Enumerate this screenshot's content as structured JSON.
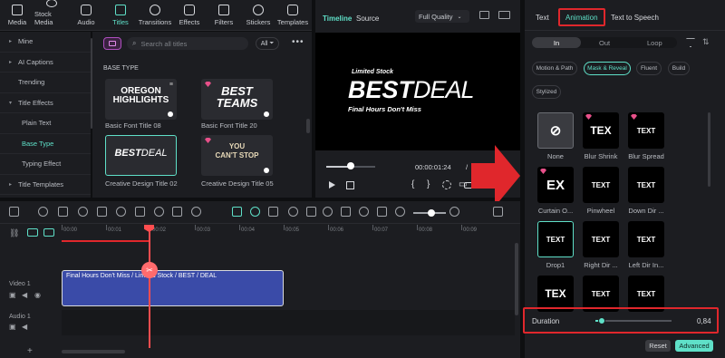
{
  "toolbar": {
    "tools": [
      {
        "label": "Media",
        "icon": "media-icon"
      },
      {
        "label": "Stock Media",
        "icon": "stock-media-icon"
      },
      {
        "label": "Audio",
        "icon": "audio-icon"
      },
      {
        "label": "Titles",
        "icon": "titles-icon"
      },
      {
        "label": "Transitions",
        "icon": "transitions-icon"
      },
      {
        "label": "Effects",
        "icon": "effects-icon"
      },
      {
        "label": "Filters",
        "icon": "filters-icon"
      },
      {
        "label": "Stickers",
        "icon": "stickers-icon"
      },
      {
        "label": "Templates",
        "icon": "templates-icon"
      }
    ],
    "active": "Titles"
  },
  "leftnav": {
    "items": [
      {
        "label": "Mine",
        "caret": "▸",
        "sub": false
      },
      {
        "label": "AI Captions",
        "caret": "▸",
        "sub": false
      },
      {
        "label": "Trending",
        "caret": "",
        "sub": false
      },
      {
        "label": "Title Effects",
        "caret": "▾",
        "sub": false
      },
      {
        "label": "Plain Text",
        "caret": "",
        "sub": true
      },
      {
        "label": "Base Type",
        "caret": "",
        "sub": true,
        "selected": true
      },
      {
        "label": "Typing Effect",
        "caret": "",
        "sub": true
      },
      {
        "label": "Title Templates",
        "caret": "▸",
        "sub": false
      }
    ]
  },
  "assets": {
    "search_placeholder": "Search all titles",
    "filter_label": "All",
    "section": "BASE TYPE",
    "items": [
      {
        "label": "Basic Font Title 08",
        "line1": "OREGON",
        "line2": "HIGHLIGHTS"
      },
      {
        "label": "Basic Font Title 20",
        "line1": "BEST",
        "line2": "TEAMS"
      },
      {
        "label": "Creative Design Title 02",
        "line1": "BEST",
        "line2": "DEAL"
      },
      {
        "label": "Creative Design Title 05",
        "line1": "YOU",
        "line2": "CAN'T STOP"
      }
    ]
  },
  "preview": {
    "tab_timeline": "Timeline",
    "tab_source": "Source",
    "quality": "Full Quality",
    "title_small": "Limited Stock",
    "title_big1": "BEST",
    "title_big2": "DEAL",
    "title_sub": "Final Hours Don't Miss",
    "timecode": "00:00:01:24",
    "slash": "/",
    "playhead_progress": 0.2
  },
  "timeline": {
    "ruler": [
      "00:00",
      "00:01",
      "00:02",
      "00:03",
      "00:04",
      "00:05",
      "00:06",
      "00:07",
      "00:08",
      "00:09"
    ],
    "clip_label": "Final Hours Don't Miss / Limited Stock / BEST / DEAL",
    "video_track": "Video 1",
    "audio_track": "Audio 1",
    "add_label": "+"
  },
  "right": {
    "tabs": [
      "Text",
      "Animation",
      "Text to Speech"
    ],
    "active_tab": "Animation",
    "subtabs": [
      "In",
      "Out",
      "Loop"
    ],
    "active_subtab": "In",
    "chips": [
      "Motion & Path",
      "Mask & Reveal",
      "Fluent",
      "Build",
      "Stylized"
    ],
    "active_chip": "Mask & Reveal",
    "animations": [
      {
        "label": "None",
        "tile": "⊘"
      },
      {
        "label": "Blur Shrink",
        "tile": "TEX"
      },
      {
        "label": "Blur Spread",
        "tile": "TEXT"
      },
      {
        "label": "Curtain O...",
        "tile": "EX"
      },
      {
        "label": "Pinwheel",
        "tile": "TEXT"
      },
      {
        "label": "Down Dir ...",
        "tile": "TEXT"
      },
      {
        "label": "Drop1",
        "tile": "TEXT"
      },
      {
        "label": "Right Dir ...",
        "tile": "TEXT"
      },
      {
        "label": "Left Dir In...",
        "tile": "TEXT"
      },
      {
        "label": "",
        "tile": "TEX"
      },
      {
        "label": "",
        "tile": "TEXT"
      },
      {
        "label": "",
        "tile": "TEXT"
      }
    ],
    "duration_label": "Duration",
    "duration_value": "0,84",
    "duration_fraction": 0.08,
    "reset_label": "Reset",
    "advanced_label": "Advanced"
  },
  "colors": {
    "accent": "#5fe0c8",
    "highlight": "#e0272c",
    "clip": "#3a4ba8",
    "playhead": "#ff4d4f"
  }
}
